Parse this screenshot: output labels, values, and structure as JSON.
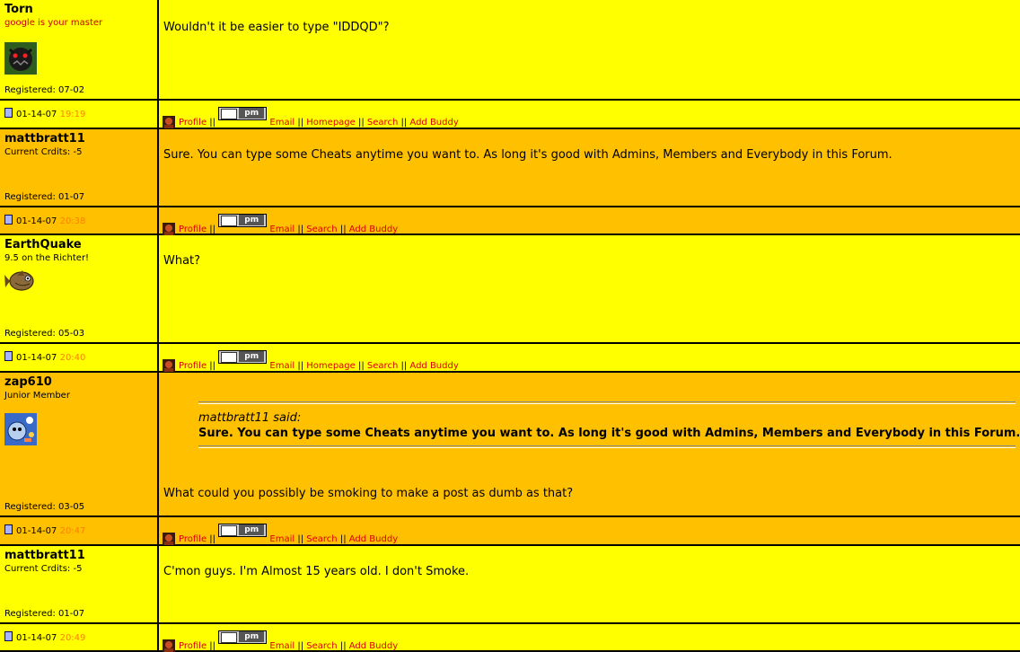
{
  "posts": [
    {
      "username": "Torn",
      "user_title": "google is your master",
      "avatar": "monster-avatar",
      "registered": "Registered: 07-02",
      "message": "Wouldn't it be easier to type \"IDDQD\"?",
      "date": "01-14-07",
      "time": "19:19",
      "links": [
        "Profile",
        "Email",
        "Homepage",
        "Search",
        "Add Buddy"
      ]
    },
    {
      "username": "mattbratt11",
      "user_title": "Current Crdits: -5",
      "registered": "Registered: 01-07",
      "message": "Sure. You can type some Cheats anytime you want to. As long it's good with Admins, Members and Everybody in this Forum.",
      "date": "01-14-07",
      "time": "20:38",
      "links": [
        "Profile",
        "Email",
        "Search",
        "Add Buddy"
      ]
    },
    {
      "username": "EarthQuake",
      "user_title": "9.5 on the Richter!",
      "avatar": "fish-avatar",
      "registered": "Registered: 05-03",
      "message": "What?",
      "date": "01-14-07",
      "time": "20:40",
      "links": [
        "Profile",
        "Email",
        "Homepage",
        "Search",
        "Add Buddy"
      ]
    },
    {
      "username": "zap610",
      "user_title": "Junior Member",
      "avatar": "blue-character-avatar",
      "registered": "Registered: 03-05",
      "quote_author": "mattbratt11 said:",
      "quote_text": "Sure. You can type some Cheats anytime you want to. As long it's good with Admins, Members and Everybody in this Forum.",
      "message": "What could you possibly be smoking to make a post as dumb as that?",
      "date": "01-14-07",
      "time": "20:47",
      "links": [
        "Profile",
        "Email",
        "Search",
        "Add Buddy"
      ]
    },
    {
      "username": "mattbratt11",
      "user_title": "Current Crdits: -5",
      "registered": "Registered: 01-07",
      "message": "C'mon guys. I'm Almost 15 years old. I don't Smoke.",
      "date": "01-14-07",
      "time": "20:49",
      "links": [
        "Profile",
        "Email",
        "Search",
        "Add Buddy"
      ]
    }
  ],
  "pm_label": "pm",
  "link_separator": "||",
  "colors": {
    "yellow_bg": "#ffff00",
    "orange_bg": "#ffc000",
    "link_red": "#dd0000",
    "time_orange": "#ff8000",
    "user_title_red": "#cc0000",
    "border": "#000000"
  }
}
